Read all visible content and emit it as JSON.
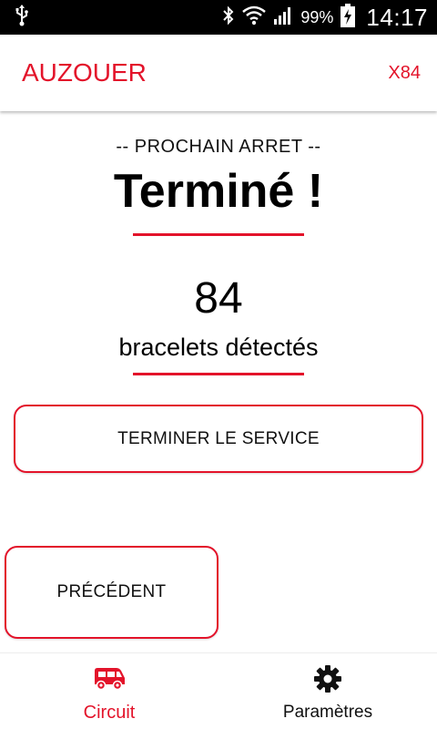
{
  "status_bar": {
    "battery_percent": "99%",
    "time": "14:17"
  },
  "app_bar": {
    "title": "AUZOUER",
    "count": "X84"
  },
  "main": {
    "next_stop_label": "-- PROCHAIN ARRET --",
    "next_stop_name": "Terminé !",
    "count_value": "84",
    "count_label": "bracelets détectés",
    "end_service_button": "TERMINER LE SERVICE",
    "previous_button": "PRÉCÉDENT"
  },
  "bottom_nav": {
    "items": [
      {
        "label": "Circuit",
        "icon": "bus-icon",
        "active": true
      },
      {
        "label": "Paramètres",
        "icon": "gear-icon",
        "active": false
      }
    ]
  },
  "colors": {
    "accent": "#e3132a",
    "status_bar_bg": "#000000",
    "background": "#ffffff"
  }
}
